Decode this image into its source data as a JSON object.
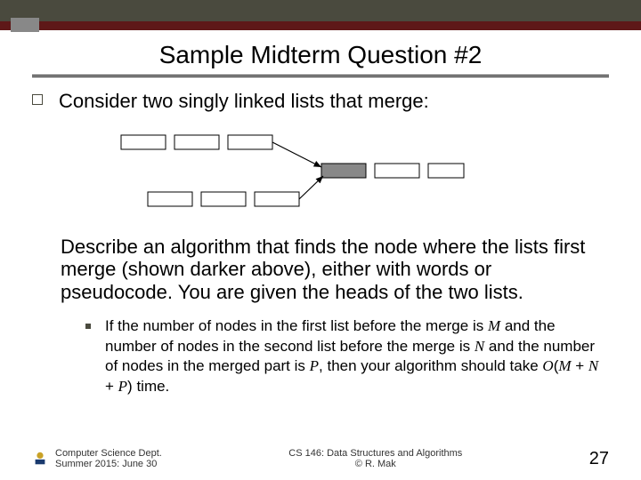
{
  "title": "Sample Midterm Question #2",
  "intro": "Consider two singly linked lists that merge:",
  "describe": "Describe an algorithm that finds the node where the lists first merge (shown darker above), either with words or pseudocode. You are given the heads of the two lists.",
  "sub_pre": "If the number of nodes in the first list before the merge is ",
  "M": "M",
  "sub_mid1": " and the number of nodes in the second list before the merge is ",
  "N": "N",
  "sub_mid2": " and the number of nodes in the merged part is ",
  "P": "P",
  "sub_mid3": ", then your algorithm should take ",
  "O": "O",
  "open": "(",
  "plus1": " + ",
  "plus2": " + ",
  "close": ")",
  "sub_post": " time.",
  "footer_dept": "Computer Science Dept.",
  "footer_date": "Summer 2015: June 30",
  "footer_course": "CS 146: Data Structures and Algorithms",
  "footer_author": "© R. Mak",
  "page_num": "27"
}
